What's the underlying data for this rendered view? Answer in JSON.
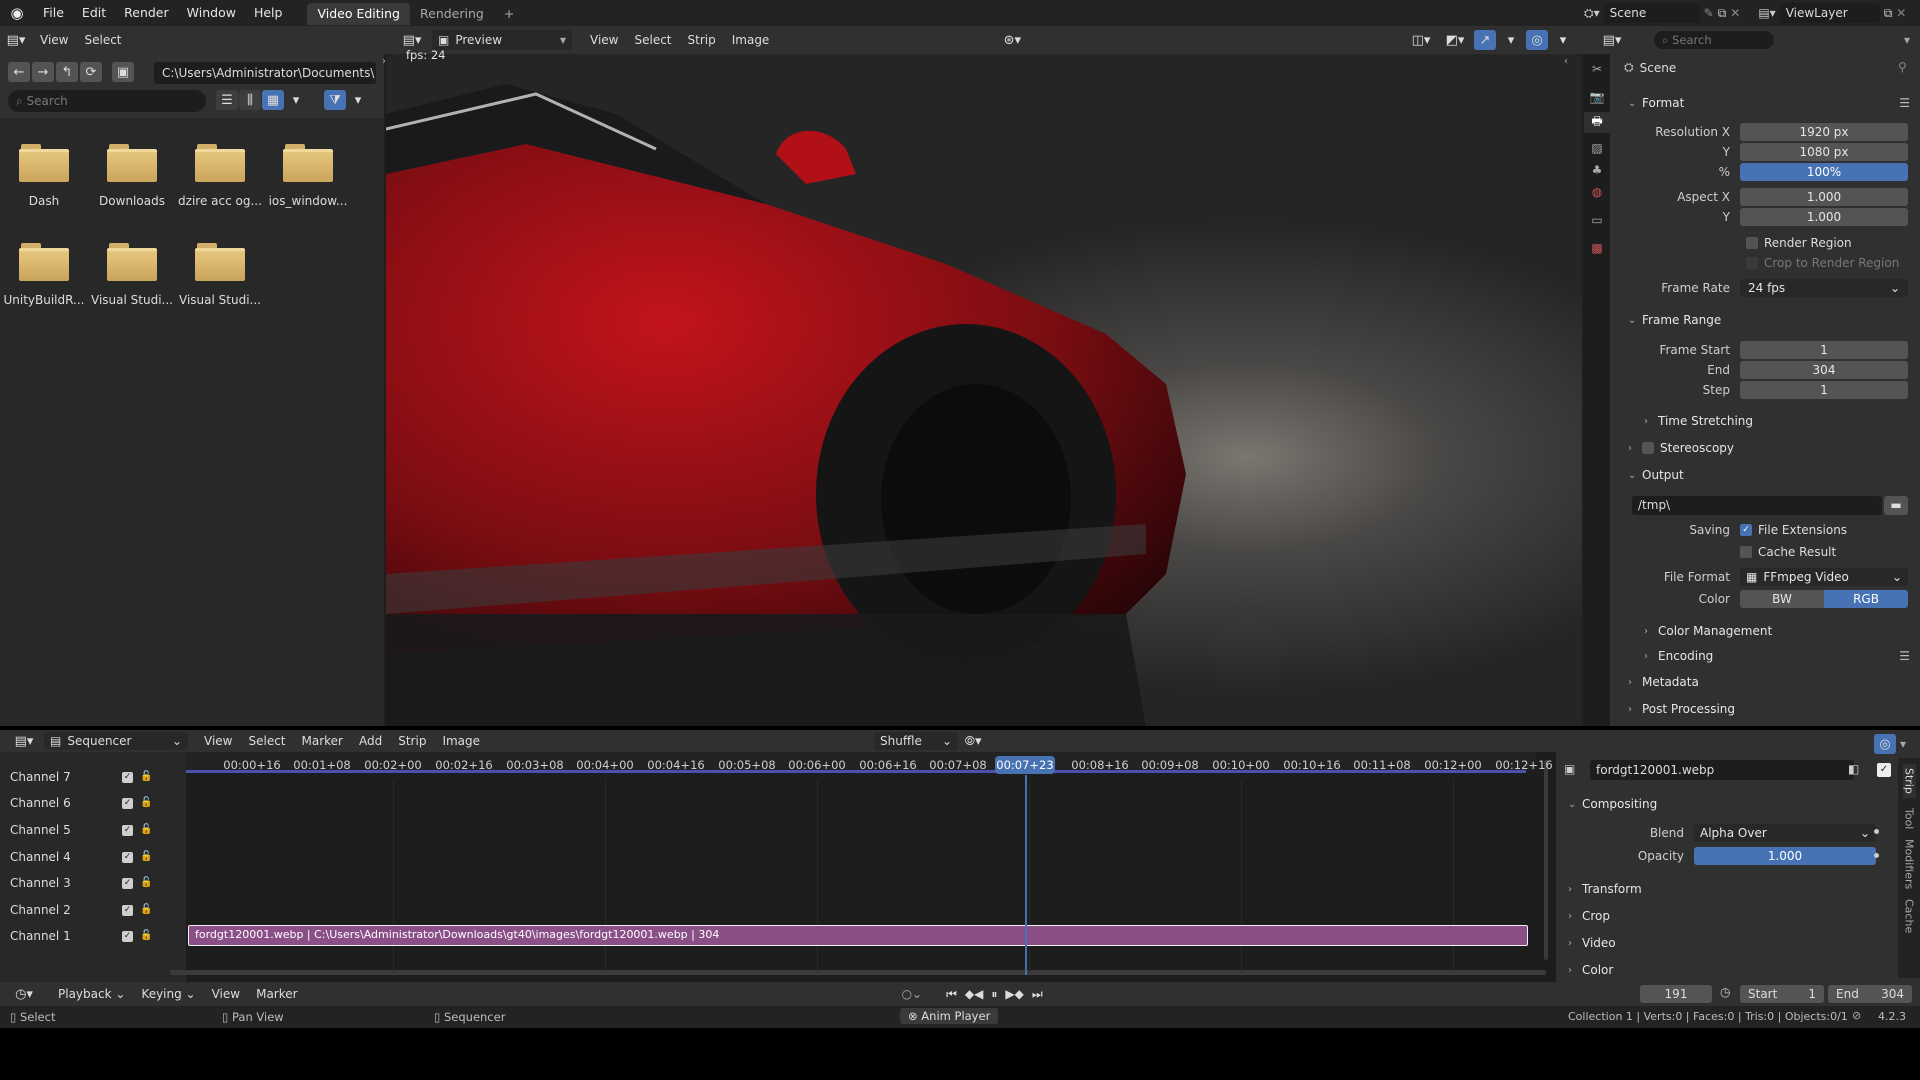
{
  "topbar": {
    "menus": [
      "File",
      "Edit",
      "Render",
      "Window",
      "Help"
    ],
    "workspaces": [
      "Video Editing",
      "Rendering"
    ],
    "add_tab": "+",
    "scene_name": "Scene",
    "view_layer": "ViewLayer"
  },
  "file_browser": {
    "header_menus": [
      "View",
      "Select"
    ],
    "path": "C:\\Users\\Administrator\\Documents\\",
    "search_placeholder": "Search",
    "items": [
      "Dash",
      "Downloads",
      "dzire acc og...",
      "ios_window...",
      "UnityBuildR...",
      "Visual Studi...",
      "Visual Studi..."
    ]
  },
  "preview": {
    "mode": "Preview",
    "menus": [
      "View",
      "Select",
      "Strip",
      "Image"
    ],
    "fps_text": "fps: 24"
  },
  "properties": {
    "search_placeholder": "Search",
    "breadcrumb": "Scene",
    "format": {
      "title": "Format",
      "resolution_x_label": "Resolution X",
      "resolution_x": "1920 px",
      "resolution_y_label": "Y",
      "resolution_y": "1080 px",
      "percent_label": "%",
      "percent": "100%",
      "aspect_x_label": "Aspect X",
      "aspect_x": "1.000",
      "aspect_y_label": "Y",
      "aspect_y": "1.000",
      "render_region": "Render Region",
      "crop_region": "Crop to Render Region",
      "frame_rate_label": "Frame Rate",
      "frame_rate": "24 fps"
    },
    "frame_range": {
      "title": "Frame Range",
      "start_label": "Frame Start",
      "start": "1",
      "end_label": "End",
      "end": "304",
      "step_label": "Step",
      "step": "1",
      "time_stretching": "Time Stretching"
    },
    "stereoscopy": "Stereoscopy",
    "output": {
      "title": "Output",
      "path": "/tmp\\",
      "saving_label": "Saving",
      "file_extensions": "File Extensions",
      "cache_result": "Cache Result",
      "file_format_label": "File Format",
      "file_format": "FFmpeg Video",
      "color_label": "Color",
      "color_bw": "BW",
      "color_rgb": "RGB",
      "color_management": "Color Management",
      "encoding": "Encoding"
    },
    "metadata": "Metadata",
    "post_processing": "Post Processing"
  },
  "sequencer": {
    "editor": "Sequencer",
    "menus": [
      "View",
      "Select",
      "Marker",
      "Add",
      "Strip",
      "Image"
    ],
    "snap": "Shuffle",
    "timecodes": [
      "00:00+16",
      "00:01+08",
      "00:02+00",
      "00:02+16",
      "00:03+08",
      "00:04+00",
      "00:04+16",
      "00:05+08",
      "00:06+00",
      "00:06+16",
      "00:07+08",
      "00:08+16",
      "00:09+08",
      "00:10+00",
      "00:10+16",
      "00:11+08",
      "00:12+00",
      "00:12+16"
    ],
    "current_time": "00:07+23",
    "channels": [
      "Channel 7",
      "Channel 6",
      "Channel 5",
      "Channel 4",
      "Channel 3",
      "Channel 2",
      "Channel 1"
    ],
    "strip_label": "fordgt120001.webp | C:\\Users\\Administrator\\Downloads\\gt40\\images\\fordgt120001.webp | 304",
    "strip_color": "#8a4f86",
    "side_tabs": [
      "Strip",
      "Tool",
      "Modifiers",
      "Cache"
    ]
  },
  "strip_panel": {
    "name": "fordgt120001.webp",
    "compositing": "Compositing",
    "blend_label": "Blend",
    "blend": "Alpha Over",
    "opacity_label": "Opacity",
    "opacity": "1.000",
    "sections": [
      "Transform",
      "Crop",
      "Video",
      "Color"
    ]
  },
  "timeline": {
    "menus": [
      "Playback",
      "Keying",
      "View",
      "Marker"
    ],
    "current_frame": "191",
    "start_label": "Start",
    "start": "1",
    "end_label": "End",
    "end": "304"
  },
  "statusbar": {
    "select": "Select",
    "pan_view": "Pan View",
    "sequencer": "Sequencer",
    "anim_player": "Anim Player",
    "stats": "Collection 1 | Verts:0 | Faces:0 | Tris:0 | Objects:0/1",
    "version": "4.2.3"
  },
  "colors": {
    "accent": "#4772b3",
    "playhead": "#4772b3",
    "strip": "#8a4f86"
  }
}
